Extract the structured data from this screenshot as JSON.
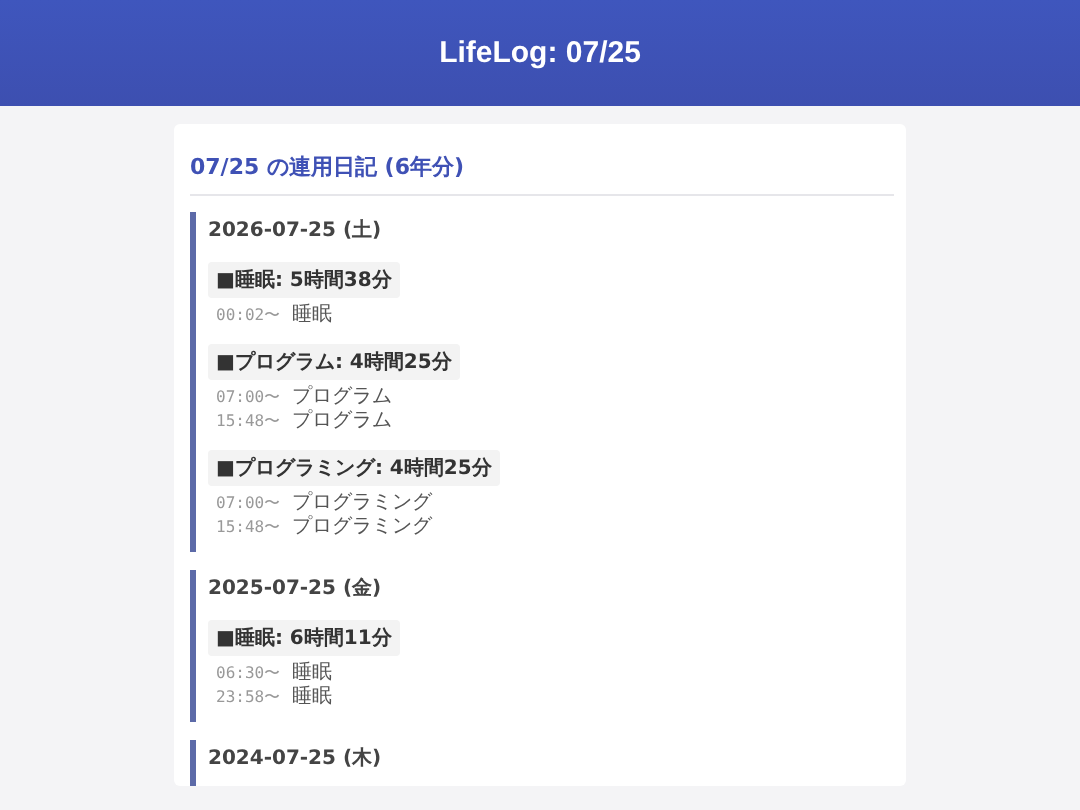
{
  "header": {
    "title": "LifeLog: 07/25"
  },
  "card": {
    "title": "07/25 の連用日記 (6年分)",
    "days": [
      {
        "date": "2026-07-25 (土)",
        "groups": [
          {
            "label": "■睡眠: 5時間38分",
            "entries": [
              {
                "time": "00:02〜",
                "text": "睡眠"
              }
            ]
          },
          {
            "label": "■プログラム: 4時間25分",
            "entries": [
              {
                "time": "07:00〜",
                "text": "プログラム"
              },
              {
                "time": "15:48〜",
                "text": "プログラム"
              }
            ]
          },
          {
            "label": "■プログラミング: 4時間25分",
            "entries": [
              {
                "time": "07:00〜",
                "text": "プログラミング"
              },
              {
                "time": "15:48〜",
                "text": "プログラミング"
              }
            ]
          }
        ]
      },
      {
        "date": "2025-07-25 (金)",
        "groups": [
          {
            "label": "■睡眠: 6時間11分",
            "entries": [
              {
                "time": "06:30〜",
                "text": "睡眠"
              },
              {
                "time": "23:58〜",
                "text": "睡眠"
              }
            ]
          }
        ]
      },
      {
        "date": "2024-07-25 (木)"
      }
    ]
  }
}
